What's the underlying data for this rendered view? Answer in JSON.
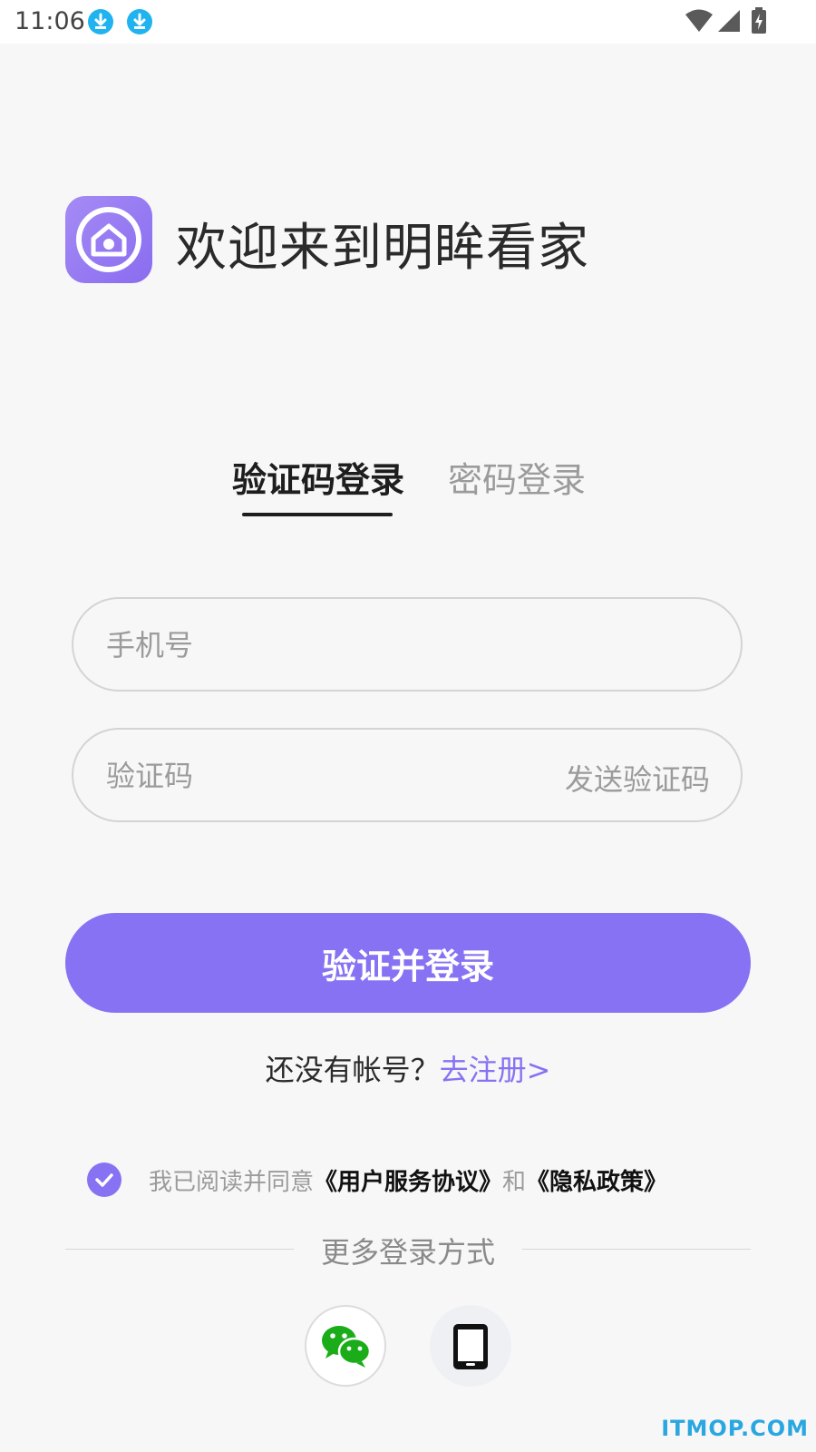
{
  "status_bar": {
    "time": "11:06",
    "icons": [
      "download-icon",
      "download-icon",
      "wifi-icon",
      "signal-icon",
      "battery-charging-icon"
    ]
  },
  "header": {
    "logo_icon": "home-camera-icon",
    "title": "欢迎来到明眸看家"
  },
  "tabs": {
    "items": [
      {
        "label": "验证码登录",
        "active": true
      },
      {
        "label": "密码登录",
        "active": false
      }
    ]
  },
  "form": {
    "phone": {
      "value": "",
      "placeholder": "手机号"
    },
    "code": {
      "value": "",
      "placeholder": "验证码"
    },
    "send_code_label": "发送验证码"
  },
  "login_button": {
    "label": "验证并登录"
  },
  "register": {
    "prompt": "还没有帐号？",
    "link": "去注册>"
  },
  "agreement": {
    "checked": true,
    "prefix": "我已阅读并同意",
    "terms_link": "《用户服务协议》",
    "conjunction": "和",
    "privacy_link": "《隐私政策》"
  },
  "more_login": {
    "label": "更多登录方式",
    "options": [
      {
        "icon": "wechat-icon"
      },
      {
        "icon": "tablet-icon"
      }
    ]
  },
  "watermark": "ITMOP.COM",
  "colors": {
    "accent": "#8672f2",
    "background": "#f7f7f8",
    "wechat_green": "#1aad19"
  }
}
